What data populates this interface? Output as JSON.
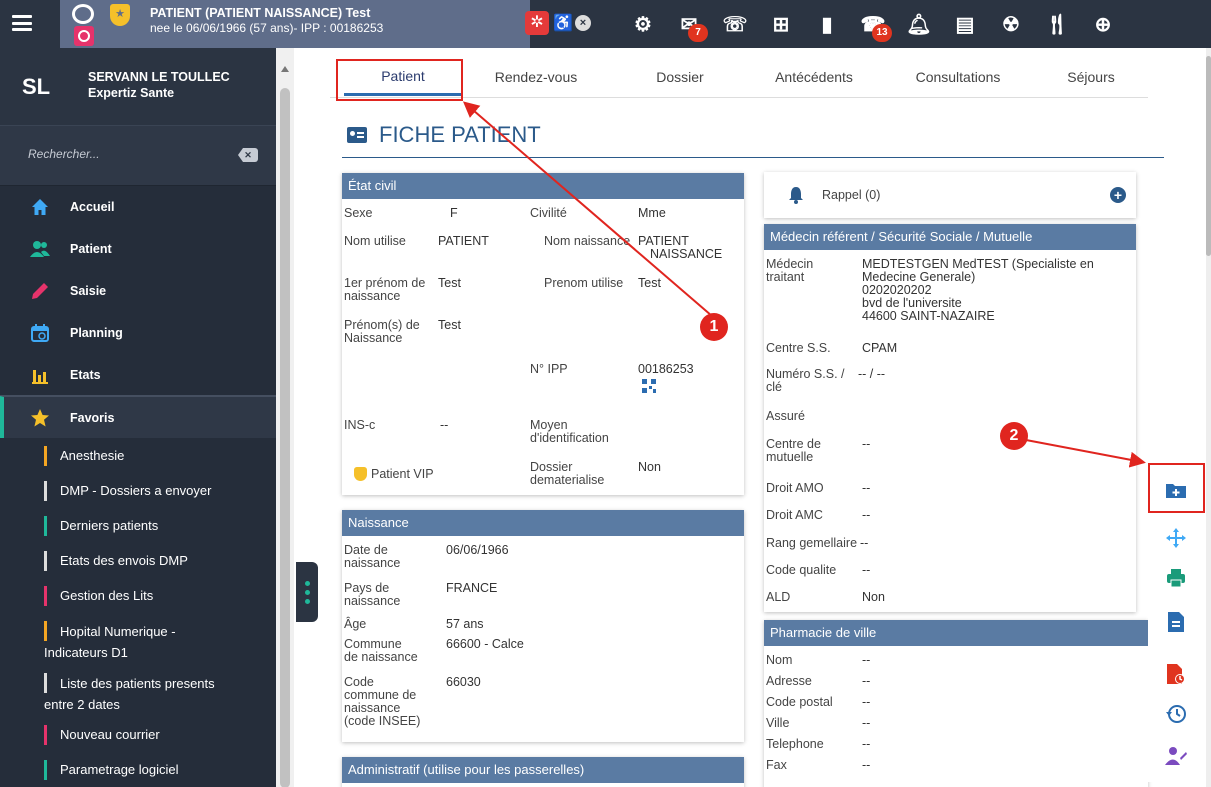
{
  "header": {
    "patient_name": "PATIENT (PATIENT NAISSANCE) Test",
    "patient_info": "nee le 06/06/1966 (57 ans)- IPP : 00186253",
    "badges": {
      "mail": "7",
      "phone": "13"
    },
    "icons": [
      "menu-icon",
      "gender-icon",
      "vip-icon",
      "virus-alert-icon",
      "accessibility-icon",
      "close-icon",
      "gear-icon",
      "mail-icon",
      "phone-list-icon",
      "plus-square-icon",
      "save-icon",
      "phone-icon",
      "bell-icon",
      "document-icon",
      "radiation-icon",
      "meal-icon",
      "globe-icon"
    ]
  },
  "sidebar": {
    "initials": "SL",
    "user_name": "SERVANN LE TOULLEC",
    "company": "Expertiz Sante",
    "search_placeholder": "Rechercher...",
    "nav": [
      {
        "label": "Accueil",
        "icon": "home-icon",
        "color": "#3fa9f5"
      },
      {
        "label": "Patient",
        "icon": "users-icon",
        "color": "#1fb89a"
      },
      {
        "label": "Saisie",
        "icon": "pencil-icon",
        "color": "#e6336b"
      },
      {
        "label": "Planning",
        "icon": "calendar-icon",
        "color": "#3fa9f5"
      },
      {
        "label": "Etats",
        "icon": "bar-chart-icon",
        "color": "#f5c02a"
      }
    ],
    "favorites_label": "Favoris",
    "favorites": [
      {
        "label": "Anesthesie",
        "color": "#f5a623"
      },
      {
        "label": "DMP - Dossiers a envoyer",
        "color": "#dddddd"
      },
      {
        "label": "Derniers patients",
        "color": "#1fb89a"
      },
      {
        "label": "Etats des envois DMP",
        "color": "#dddddd"
      },
      {
        "label": "Gestion des Lits",
        "color": "#e6336b"
      },
      {
        "label": "Hopital Numerique -",
        "label2": "Indicateurs D1",
        "color": "#f5a623"
      },
      {
        "label": "Liste des patients presents",
        "label2": "entre 2 dates",
        "color": "#dddddd"
      },
      {
        "label": "Nouveau courrier",
        "color": "#e6336b"
      },
      {
        "label": "Parametrage logiciel",
        "color": "#1fb89a"
      }
    ]
  },
  "tabs": [
    "Patient",
    "Rendez-vous",
    "Dossier",
    "Antécédents",
    "Consultations",
    "Séjours"
  ],
  "page_title": "FICHE PATIENT",
  "etat_civil": {
    "title": "État civil",
    "sexe_l": "Sexe",
    "sexe_v": "F",
    "civilite_l": "Civilité",
    "civilite_v": "Mme",
    "nom_util_l": "Nom utilise",
    "nom_util_v": "PATIENT",
    "nom_naiss_l": "Nom naissance",
    "nom_naiss_v1": "PATIENT",
    "nom_naiss_v2": "NAISSANCE",
    "prenom1_l1": "1er prénom de",
    "prenom1_l2": "naissance",
    "prenom1_v": "Test",
    "prenom_util_l": "Prenom utilise",
    "prenom_util_v": "Test",
    "prenoms_l1": "Prénom(s) de",
    "prenoms_l2": "Naissance",
    "prenoms_v": "Test",
    "ipp_l": "N° IPP",
    "ipp_v": "00186253",
    "insc_l": "INS-c",
    "insc_v": "--",
    "moyen_l1": "Moyen",
    "moyen_l2": "d'identification",
    "vip": "Patient VIP",
    "dossier_l1": "Dossier",
    "dossier_l2": "dematerialise",
    "dossier_v": "Non"
  },
  "naissance": {
    "title": "Naissance",
    "date_l1": "Date de",
    "date_l2": "naissance",
    "date_v": "06/06/1966",
    "pays_l1": "Pays de",
    "pays_l2": "naissance",
    "pays_v": "FRANCE",
    "age_l": "Âge",
    "age_v": "57 ans",
    "commune_l1": "Commune",
    "commune_l2": "de naissance",
    "commune_v": "66600 - Calce",
    "code_l1": "Code",
    "code_l2": "commune de",
    "code_l3": "naissance",
    "code_l4": "(code INSEE)",
    "code_v": "66030"
  },
  "administratif": {
    "title": "Administratif (utilise pour les passerelles)"
  },
  "rappel": {
    "label": "Rappel (0)"
  },
  "medecin": {
    "title": "Médecin référent / Sécurité Sociale / Mutuelle",
    "traitant_l1": "Médecin",
    "traitant_l2": "traitant",
    "traitant_v1": "MEDTESTGEN MedTEST (Specialiste en",
    "traitant_v2": "Medecine Generale)",
    "traitant_v3": "0202020202",
    "traitant_v4": "bvd de l'universite",
    "traitant_v5": "44600 SAINT-NAZAIRE",
    "centre_l": "Centre S.S.",
    "centre_v": "CPAM",
    "numero_l1": "Numéro S.S. /",
    "numero_l2": "clé",
    "numero_v": "-- / --",
    "assure_l": "Assuré",
    "mutuelle_l1": "Centre de",
    "mutuelle_l2": "mutuelle",
    "mutuelle_v": "--",
    "amo_l": "Droit AMO",
    "amo_v": "--",
    "amc_l": "Droit AMC",
    "amc_v": "--",
    "rang_l": "Rang gemellaire",
    "rang_v": "--",
    "qualite_l": "Code qualite",
    "qualite_v": "--",
    "ald_l": "ALD",
    "ald_v": "Non"
  },
  "pharmacie": {
    "title": "Pharmacie de ville",
    "nom_l": "Nom",
    "nom_v": "--",
    "adresse_l": "Adresse",
    "adresse_v": "--",
    "cp_l": "Code postal",
    "cp_v": "--",
    "ville_l": "Ville",
    "ville_v": "--",
    "tel_l": "Telephone",
    "tel_v": "--",
    "fax_l": "Fax",
    "fax_v": "--"
  },
  "annotations": {
    "one": "1",
    "two": "2"
  },
  "colors": {
    "accent": "#e0251f",
    "panel_header": "#5a7ba3",
    "topbar": "#2b3442",
    "sidebar": "#252d3a"
  }
}
